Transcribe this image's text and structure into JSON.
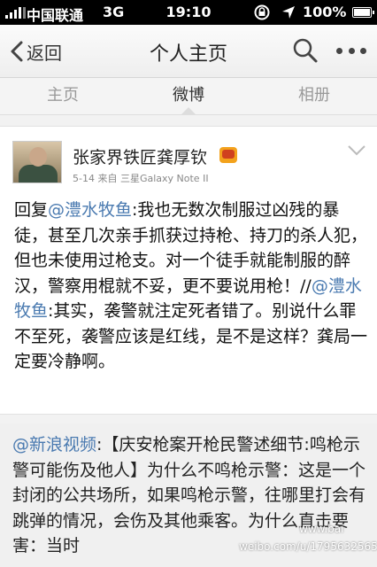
{
  "statusbar": {
    "carrier": "中国联通",
    "network": "3G",
    "time": "19:10",
    "battery": "100%",
    "battery_level": 1.0
  },
  "navbar": {
    "back_label": "返回",
    "title": "个人主页"
  },
  "tabs": [
    {
      "label": "主页"
    },
    {
      "label": "微博"
    },
    {
      "label": "相册"
    }
  ],
  "post": {
    "username": "张家界铁匠龚厚钦",
    "meta": "5-14  来自 三星Galaxy Note II",
    "text_segments": [
      {
        "t": "回复",
        "m": false
      },
      {
        "t": "@澧水牧鱼",
        "m": true
      },
      {
        "t": ":我也无数次制服过凶残的暴徒，甚至几次亲手抓获过持枪、持刀的杀人犯，但也未使用过枪支。对一个徒手就能制服的醉汉，警察用棍就不妥，更不要说用枪！//",
        "m": false
      },
      {
        "t": "@澧水牧鱼",
        "m": true
      },
      {
        "t": ":其实，袭警就注定死者错了。别说什么罪不至死，袭警应该是红线，是不是这样？龚局一定要冷静啊。",
        "m": false
      }
    ]
  },
  "repost": {
    "mention": "@新浪视频",
    "text": ":【庆安枪案开枪民警述细节:鸣枪示警可能伤及他人】为什么不鸣枪示警：这是一个封闭的公共场所，如果鸣枪示警，往哪里打会有跳弹的情况，会伤及其他乘客。为什么直击要害：当时"
  },
  "watermark": {
    "line1": "www.bai",
    "line2": "weibo.com/u/1795632565"
  }
}
